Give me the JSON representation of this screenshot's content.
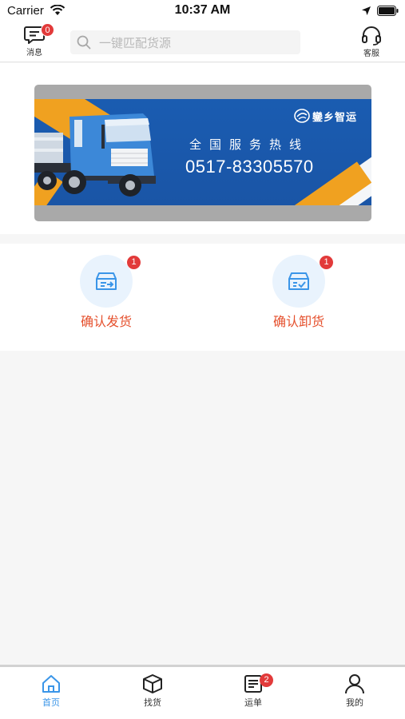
{
  "status_bar": {
    "carrier": "Carrier",
    "time": "10:37 AM"
  },
  "header": {
    "messages_label": "消息",
    "messages_badge": "0",
    "search_placeholder": "一键匹配货源",
    "service_label": "客服"
  },
  "banner": {
    "brand": "鑾乡智运",
    "hotline_label": "全国服务热线",
    "hotline_number": "0517-83305570"
  },
  "actions": [
    {
      "label": "确认发货",
      "badge": "1",
      "icon": "outbox-arrow-icon"
    },
    {
      "label": "确认卸货",
      "badge": "1",
      "icon": "box-check-icon"
    }
  ],
  "tabbar": {
    "items": [
      {
        "label": "首页",
        "icon": "home-icon",
        "active": true
      },
      {
        "label": "找货",
        "icon": "package-icon",
        "active": false
      },
      {
        "label": "运单",
        "icon": "waybill-icon",
        "active": false,
        "badge": "2"
      },
      {
        "label": "我的",
        "icon": "user-icon",
        "active": false
      }
    ]
  },
  "colors": {
    "accent": "#3a95e8",
    "action_text": "#e5502d",
    "badge": "#e23a3a",
    "banner_blue": "#1a5cb1",
    "banner_stripe": "#f0a120"
  }
}
